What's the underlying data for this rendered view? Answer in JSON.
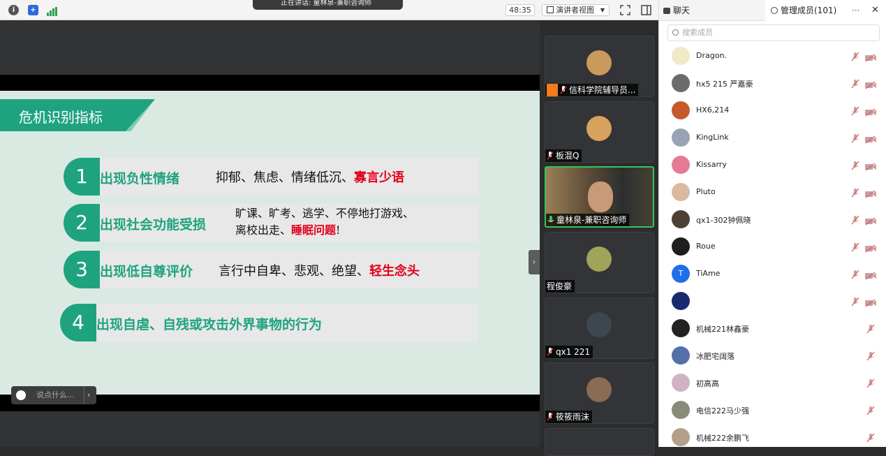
{
  "toolbar": {
    "speaking_text": "正在讲话: 童林泉-兼职咨询师",
    "timer": "48:35",
    "view_mode": "演讲者视图"
  },
  "slide": {
    "title": "危机识别指标",
    "items": [
      {
        "num": "1",
        "head": "出现负性情绪",
        "desc": "抑郁、焦虑、情绪低沉、",
        "desc_red": "寡言少语"
      },
      {
        "num": "2",
        "head": "出现社会功能受损",
        "desc_line1": "旷课、旷考、逃学、不停地打游戏、",
        "desc_line2": "离校出走、",
        "desc_red": "睡眠问题",
        "desc_end": "!"
      },
      {
        "num": "3",
        "head": "出现低自尊评价",
        "desc": "言行中自卑、悲观、绝望、",
        "desc_red": "轻生念头"
      },
      {
        "num": "4",
        "head": "出现自虐、自残或攻击外界事物的行为"
      }
    ]
  },
  "chat_input": {
    "placeholder": "说点什么..."
  },
  "videos": [
    {
      "name": "信科学院辅导员...",
      "avatar_color": "#c99a5b"
    },
    {
      "name": "板混Q",
      "avatar_color": "#d7a35c"
    },
    {
      "name": "童林泉-兼职咨询师",
      "avatar_color": "#6b5a3d"
    },
    {
      "name": "程俊豪",
      "avatar_color": "#a1a35a"
    },
    {
      "name": "qx1 221",
      "avatar_color": "#3c4750"
    },
    {
      "name": "筱筱雨沫",
      "avatar_color": "#8a6b54"
    }
  ],
  "sidebar": {
    "tab_chat": "聊天",
    "tab_members": "管理成员(101)",
    "search_placeholder": "搜索成员",
    "members": [
      {
        "name": "Dragon.",
        "avatar_color": "#f2e9c7",
        "cam": true
      },
      {
        "name": "hx5 215 严嘉豪",
        "avatar_color": "#6b6b6b",
        "cam": true
      },
      {
        "name": "HX6,214",
        "avatar_color": "#c45a2a",
        "cam": true
      },
      {
        "name": "KingLink",
        "avatar_color": "#9aa3b5",
        "cam": true
      },
      {
        "name": "Kissarry",
        "avatar_color": "#e47b93",
        "cam": true
      },
      {
        "name": "Pluto",
        "avatar_color": "#d9b9a0",
        "cam": true
      },
      {
        "name": "qx1-302钟佩晓",
        "avatar_color": "#4d4034",
        "cam": true
      },
      {
        "name": "Roue",
        "avatar_color": "#1e1e1e",
        "cam": true
      },
      {
        "name": "TiAme",
        "avatar_color": "#1e6fe8",
        "initial": "T",
        "cam": true
      },
      {
        "name": "",
        "avatar_color": "#1a2a6e",
        "cam": true
      },
      {
        "name": "机械221林鑫豪",
        "avatar_color": "#222222",
        "cam": false
      },
      {
        "name": "冰肥宅阔落",
        "avatar_color": "#5570a8",
        "cam": false
      },
      {
        "name": "初高高",
        "avatar_color": "#cfb3c3",
        "cam": false
      },
      {
        "name": "电信222马少强",
        "avatar_color": "#8a8a7a",
        "cam": false
      },
      {
        "name": "机械222余鹏飞",
        "avatar_color": "#b4a08a",
        "cam": false
      }
    ]
  }
}
